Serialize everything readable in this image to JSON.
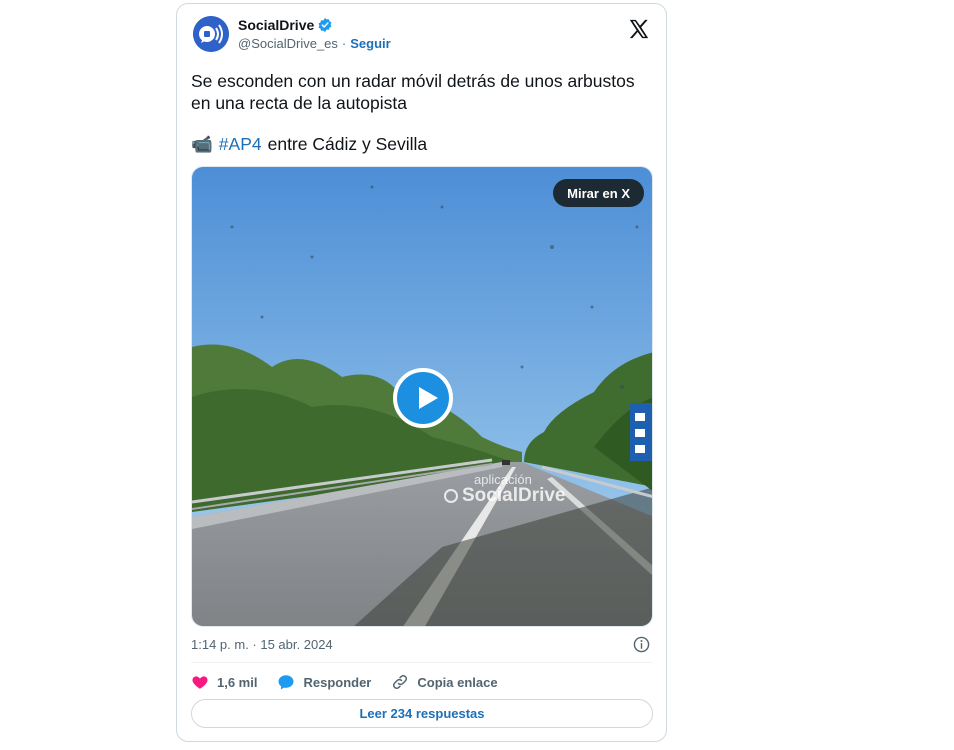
{
  "account": {
    "name": "SocialDrive",
    "handle": "@SocialDrive_es",
    "separator": "·",
    "follow_label": "Seguir"
  },
  "tweet": {
    "text": "Se esconden con un radar móvil detrás de unos arbustos en una recta de la autopista",
    "emoji": "📹",
    "hashtag": "#AP4",
    "line_rest": "entre Cádiz y Sevilla"
  },
  "media": {
    "watch_label": "Mirar en X",
    "watermark_top": "aplicación",
    "watermark_brand": "SocialDrive"
  },
  "meta": {
    "timestamp": "1:14 p. m. · 15 abr. 2024"
  },
  "actions": {
    "likes": "1,6 mil",
    "reply_label": "Responder",
    "copy_label": "Copia enlace"
  },
  "replies_button": "Leer 234 respuestas",
  "colors": {
    "accent": "#1d70b8",
    "like": "#f91880",
    "play": "#1d8fe0"
  },
  "icons": [
    "verified-icon",
    "x-logo-icon",
    "play-icon",
    "info-icon",
    "heart-icon",
    "reply-icon",
    "link-icon"
  ]
}
